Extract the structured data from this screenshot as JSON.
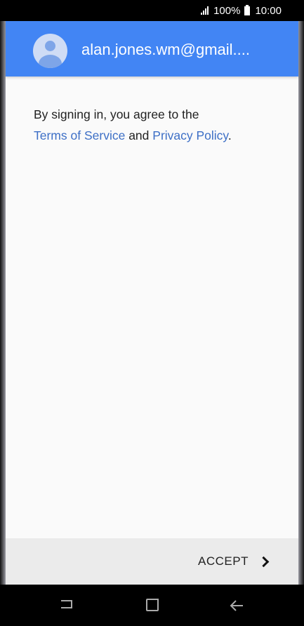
{
  "status_bar": {
    "battery_text": "100%",
    "time": "10:00"
  },
  "header": {
    "email": "alan.jones.wm@gmail....",
    "avatar_icon": "account-circle-icon",
    "color": "#4285f4"
  },
  "content": {
    "intro": "By signing in, you agree to the",
    "terms_link": "Terms of Service",
    "connector": "and",
    "privacy_link": "Privacy Policy",
    "period": ".",
    "link_color": "#3d6fc6"
  },
  "footer": {
    "accept_label": "ACCEPT",
    "accept_icon": "chevron-right-icon"
  },
  "nav_bar": {
    "icons": [
      "recent-apps-icon",
      "home-icon",
      "back-icon"
    ]
  }
}
